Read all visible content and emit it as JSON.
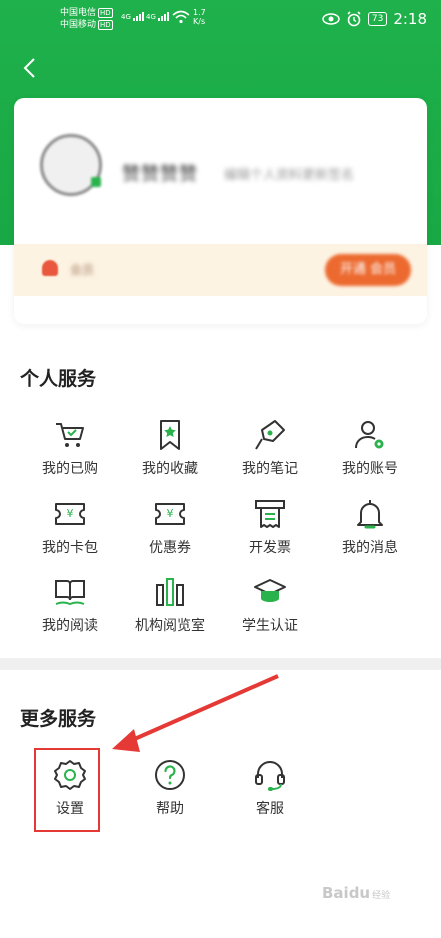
{
  "status_bar": {
    "carrier1": "中国电信",
    "carrier2": "中国移动",
    "hd_label": "HD",
    "net_type": "4G",
    "speed_value": "1.7",
    "speed_unit": "K/s",
    "battery": "73",
    "time": "2:18"
  },
  "header": {
    "back_icon": "chevron-left-icon"
  },
  "profile": {
    "username": "赞赞赞赞",
    "description": "编辑个人资料更新签名",
    "vip_text": "会员",
    "vip_button": "开通 会员"
  },
  "personal_services": {
    "title": "个人服务",
    "items": [
      {
        "label": "我的已购",
        "icon": "cart-check-icon"
      },
      {
        "label": "我的收藏",
        "icon": "bookmark-star-icon"
      },
      {
        "label": "我的笔记",
        "icon": "pen-icon"
      },
      {
        "label": "我的账号",
        "icon": "user-gear-icon"
      },
      {
        "label": "我的卡包",
        "icon": "wallet-yen-icon"
      },
      {
        "label": "优惠券",
        "icon": "coupon-yen-icon"
      },
      {
        "label": "开发票",
        "icon": "invoice-icon"
      },
      {
        "label": "我的消息",
        "icon": "bell-icon"
      },
      {
        "label": "我的阅读",
        "icon": "open-book-icon"
      },
      {
        "label": "机构阅览室",
        "icon": "bookshelf-icon"
      },
      {
        "label": "学生认证",
        "icon": "graduation-cap-icon"
      }
    ]
  },
  "more_services": {
    "title": "更多服务",
    "items": [
      {
        "label": "设置",
        "icon": "gear-icon"
      },
      {
        "label": "帮助",
        "icon": "help-icon"
      },
      {
        "label": "客服",
        "icon": "headset-icon"
      }
    ]
  },
  "colors": {
    "brand_green": "#1fb14b",
    "annotation_red": "#e53935",
    "vip_orange": "#ec6a30"
  },
  "watermark": {
    "brand": "Baidu",
    "sub": "经验"
  }
}
